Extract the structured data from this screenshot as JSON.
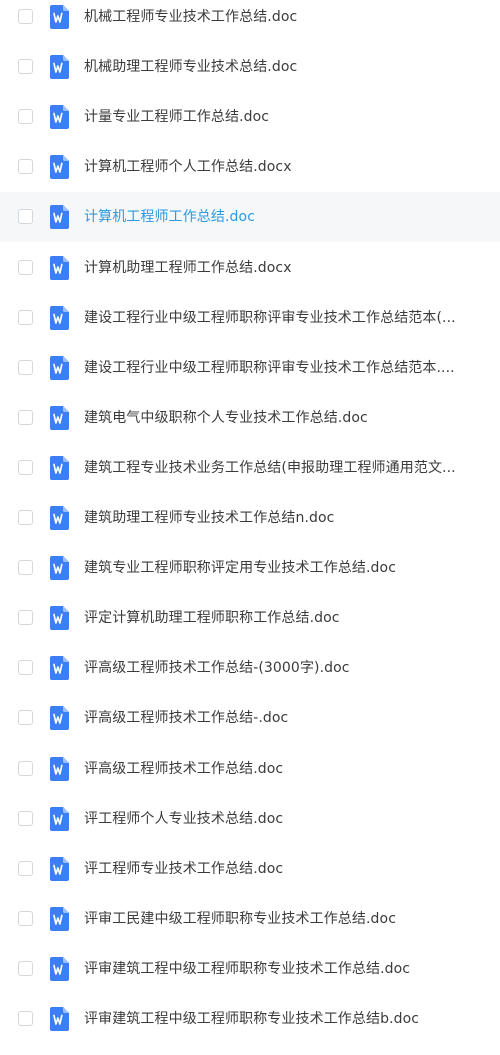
{
  "colors": {
    "icon_blue": "#3a7ff6",
    "hover_text": "#2d9ae0",
    "text": "#3b3b3b",
    "hover_bg": "#f6f7f9"
  },
  "icons": {
    "file": "word-doc-icon"
  },
  "files": [
    {
      "name": "机械工程师专业技术工作总结.doc"
    },
    {
      "name": "机械助理工程师专业技术总结.doc"
    },
    {
      "name": "计量专业工程师工作总结.doc"
    },
    {
      "name": "计算机工程师个人工作总结.docx"
    },
    {
      "name": "计算机工程师工作总结.doc",
      "hovered": true
    },
    {
      "name": "计算机助理工程师工作总结.docx"
    },
    {
      "name": "建设工程行业中级工程师职称评审专业技术工作总结范本(..."
    },
    {
      "name": "建设工程行业中级工程师职称评审专业技术工作总结范本...."
    },
    {
      "name": "建筑电气中级职称个人专业技术工作总结.doc"
    },
    {
      "name": "建筑工程专业技术业务工作总结(申报助理工程师通用范文..."
    },
    {
      "name": "建筑助理工程师专业技术工作总结n.doc"
    },
    {
      "name": "建筑专业工程师职称评定用专业技术工作总结.doc"
    },
    {
      "name": "评定计算机助理工程师职称工作总结.doc"
    },
    {
      "name": "评高级工程师技术工作总结-(3000字).doc"
    },
    {
      "name": "评高级工程师技术工作总结-.doc"
    },
    {
      "name": "评高级工程师技术工作总结.doc"
    },
    {
      "name": "评工程师个人专业技术总结.doc"
    },
    {
      "name": "评工程师专业技术工作总结.doc"
    },
    {
      "name": "评审工民建中级工程师职称专业技术工作总结.doc"
    },
    {
      "name": "评审建筑工程中级工程师职称专业技术工作总结.doc"
    },
    {
      "name": "评审建筑工程中级工程师职称专业技术工作总结b.doc"
    }
  ]
}
